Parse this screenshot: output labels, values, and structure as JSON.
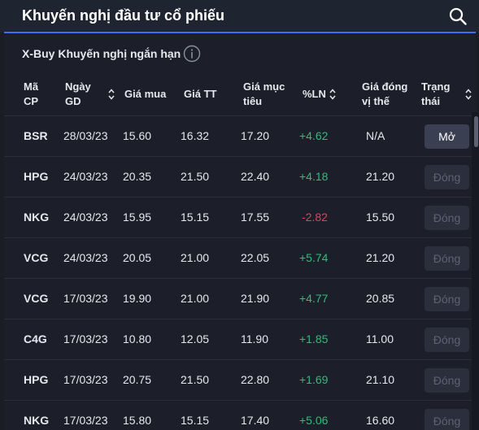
{
  "header": {
    "title": "Khuyến nghị đầu tư cổ phiếu",
    "search_icon": "search-icon"
  },
  "section": {
    "title": "X-Buy Khuyến nghị ngắn hạn",
    "info_icon": "info-icon"
  },
  "columns": {
    "code": [
      "Mã",
      "CP"
    ],
    "date": [
      "Ngày",
      "GD"
    ],
    "buy": "Giá mua",
    "current": "Giá TT",
    "target": [
      "Giá mục",
      "tiêu"
    ],
    "profit": "%LN",
    "close": [
      "Giá đóng",
      "vị thế"
    ],
    "status": [
      "Trạng",
      "thái"
    ]
  },
  "rows": [
    {
      "code": "BSR",
      "date": "28/03/23",
      "buy": "15.60",
      "current": "16.32",
      "target": "17.20",
      "profit": "+4.62",
      "close": "N/A",
      "status": "Mở"
    },
    {
      "code": "HPG",
      "date": "24/03/23",
      "buy": "20.35",
      "current": "21.50",
      "target": "22.40",
      "profit": "+4.18",
      "close": "21.20",
      "status": "Đóng"
    },
    {
      "code": "NKG",
      "date": "24/03/23",
      "buy": "15.95",
      "current": "15.15",
      "target": "17.55",
      "profit": "-2.82",
      "close": "15.50",
      "status": "Đóng"
    },
    {
      "code": "VCG",
      "date": "24/03/23",
      "buy": "20.05",
      "current": "21.00",
      "target": "22.05",
      "profit": "+5.74",
      "close": "21.20",
      "status": "Đóng"
    },
    {
      "code": "VCG",
      "date": "17/03/23",
      "buy": "19.90",
      "current": "21.00",
      "target": "21.90",
      "profit": "+4.77",
      "close": "20.85",
      "status": "Đóng"
    },
    {
      "code": "C4G",
      "date": "17/03/23",
      "buy": "10.80",
      "current": "12.05",
      "target": "11.90",
      "profit": "+1.85",
      "close": "11.00",
      "status": "Đóng"
    },
    {
      "code": "HPG",
      "date": "17/03/23",
      "buy": "20.75",
      "current": "21.50",
      "target": "22.80",
      "profit": "+1.69",
      "close": "21.10",
      "status": "Đóng"
    },
    {
      "code": "NKG",
      "date": "17/03/23",
      "buy": "15.80",
      "current": "15.15",
      "target": "17.40",
      "profit": "+5.06",
      "close": "16.60",
      "status": "Đóng"
    }
  ],
  "colors": {
    "positive": "#2dbd7c",
    "negative": "#e0425a",
    "accent": "#3d6ef5"
  }
}
